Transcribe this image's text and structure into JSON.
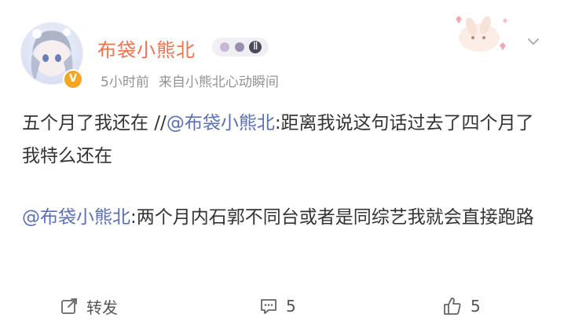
{
  "post": {
    "username": "布袋小熊北",
    "member_badge": "Ⅱ",
    "time": "5小时前",
    "source": "来自小熊北心动瞬间",
    "content": {
      "text_before": "五个月了我还在 //",
      "mention": "@布袋小熊北",
      "text_after": ":距离我说这句话过去了四个月了我特么还在"
    },
    "retweet": {
      "mention": "@布袋小熊北",
      "text": ":两个月内石郭不同台或者是同综艺我就会直接跑路"
    }
  },
  "actions": {
    "repost_label": "转发",
    "comment_count": "5",
    "like_count": "5"
  },
  "colors": {
    "username": "#eb7350",
    "mention": "#5b6fb8",
    "meta": "#939393",
    "verify_badge": "#f5a623"
  },
  "icons": [
    "verified-badge-icon",
    "chevron-down-icon",
    "repost-icon",
    "comment-icon",
    "like-icon"
  ]
}
